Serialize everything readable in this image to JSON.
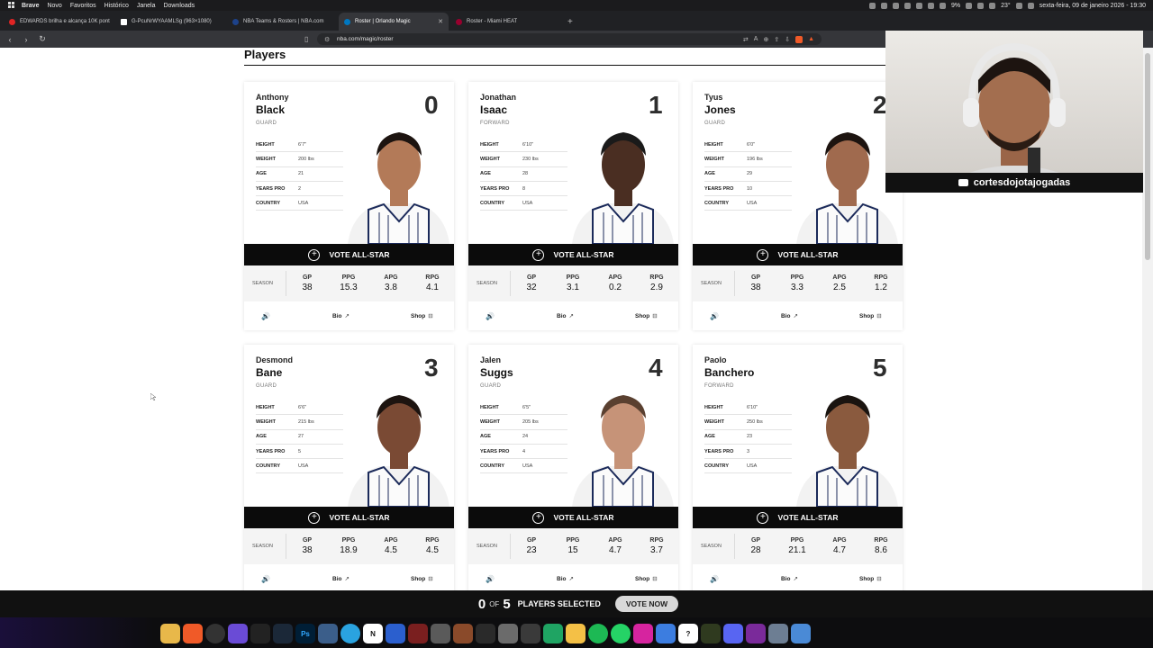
{
  "menubar": {
    "app": "Brave",
    "items": [
      "Novo",
      "Favoritos",
      "Histórico",
      "Janela",
      "Downloads"
    ],
    "battery": "9%",
    "weather": "23°",
    "datetime": "sexta-feira, 09 de janeiro 2026 - 19:30"
  },
  "tabs": [
    {
      "title": "EDWARDS brilha e alcança 10K pont",
      "color": "#e02424"
    },
    {
      "title": "G-PcuNrWYAAMLSg (963×1080)",
      "color": "#ffffff"
    },
    {
      "title": "NBA Teams & Rosters | NBA.com",
      "color": "#1d428a"
    },
    {
      "title": "Roster | Orlando Magic",
      "color": "#0077c0",
      "active": true
    },
    {
      "title": "Roster - Miami HEAT",
      "color": "#98002e"
    }
  ],
  "address": {
    "url": "nba.com/magic/roster"
  },
  "page": {
    "section_title": "Players",
    "vote_label": "VOTE ALL-STAR",
    "season_label": "SEASON",
    "bio_label": "Bio",
    "shop_label": "Shop",
    "attr_labels": {
      "height": "HEIGHT",
      "weight": "WEIGHT",
      "age": "AGE",
      "years_pro": "YEARS PRO",
      "country": "COUNTRY"
    },
    "stat_labels": {
      "gp": "GP",
      "ppg": "PPG",
      "apg": "APG",
      "rpg": "RPG"
    }
  },
  "players": [
    {
      "first": "Anthony",
      "last": "Black",
      "pos": "GUARD",
      "number": "0",
      "height": "6'7\"",
      "weight": "200 lbs",
      "age": "21",
      "years_pro": "2",
      "country": "USA",
      "gp": "38",
      "ppg": "15.3",
      "apg": "3.8",
      "rpg": "4.1",
      "skin": "#b37a58",
      "hair": "#1d1410"
    },
    {
      "first": "Jonathan",
      "last": "Isaac",
      "pos": "FORWARD",
      "number": "1",
      "height": "6'10\"",
      "weight": "230 lbs",
      "age": "28",
      "years_pro": "8",
      "country": "USA",
      "gp": "32",
      "ppg": "3.1",
      "apg": "0.2",
      "rpg": "2.9",
      "skin": "#4a2e22",
      "hair": "#1a1a1a"
    },
    {
      "first": "Tyus",
      "last": "Jones",
      "pos": "GUARD",
      "number": "2",
      "height": "6'0\"",
      "weight": "196 lbs",
      "age": "29",
      "years_pro": "10",
      "country": "USA",
      "gp": "38",
      "ppg": "3.3",
      "apg": "2.5",
      "rpg": "1.2",
      "skin": "#a06a4e",
      "hair": "#1d1410"
    },
    {
      "first": "Desmond",
      "last": "Bane",
      "pos": "GUARD",
      "number": "3",
      "height": "6'6\"",
      "weight": "215 lbs",
      "age": "27",
      "years_pro": "5",
      "country": "USA",
      "gp": "38",
      "ppg": "18.9",
      "apg": "4.5",
      "rpg": "4.5",
      "skin": "#7a4a34",
      "hair": "#1d1410"
    },
    {
      "first": "Jalen",
      "last": "Suggs",
      "pos": "GUARD",
      "number": "4",
      "height": "6'5\"",
      "weight": "205 lbs",
      "age": "24",
      "years_pro": "4",
      "country": "USA",
      "gp": "23",
      "ppg": "15",
      "apg": "4.7",
      "rpg": "3.7",
      "skin": "#c69378",
      "hair": "#5a4030"
    },
    {
      "first": "Paolo",
      "last": "Banchero",
      "pos": "FORWARD",
      "number": "5",
      "height": "6'10\"",
      "weight": "250 lbs",
      "age": "23",
      "years_pro": "3",
      "country": "USA",
      "gp": "28",
      "ppg": "21.1",
      "apg": "4.7",
      "rpg": "8.6",
      "skin": "#8a5a3e",
      "hair": "#1a1410"
    }
  ],
  "cam": {
    "handle": "cortesdojotajogadas"
  },
  "votebar": {
    "selected": "0",
    "of": "OF",
    "max": "5",
    "label": "PLAYERS SELECTED",
    "button": "VOTE NOW"
  }
}
